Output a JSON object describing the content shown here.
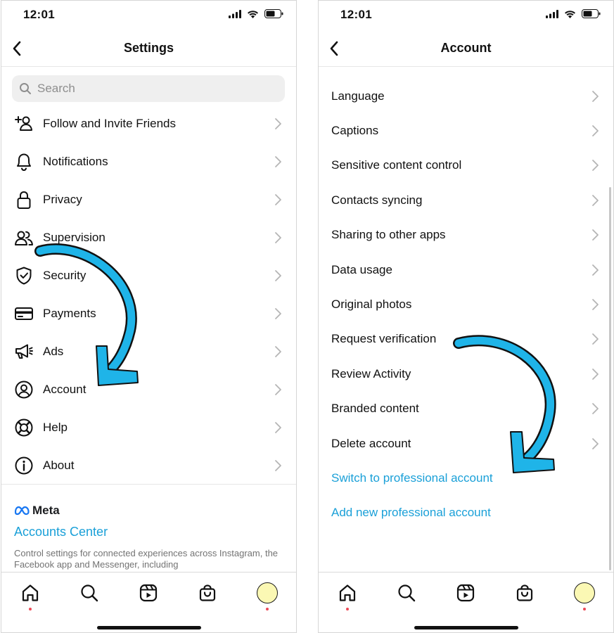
{
  "status": {
    "time": "12:01"
  },
  "left": {
    "title": "Settings",
    "search": {
      "placeholder": "Search",
      "value": ""
    },
    "items": [
      {
        "label": "Follow and Invite Friends",
        "icon": "add-person-icon"
      },
      {
        "label": "Notifications",
        "icon": "bell-icon"
      },
      {
        "label": "Privacy",
        "icon": "lock-icon"
      },
      {
        "label": "Supervision",
        "icon": "people-icon"
      },
      {
        "label": "Security",
        "icon": "shield-check-icon"
      },
      {
        "label": "Payments",
        "icon": "card-icon"
      },
      {
        "label": "Ads",
        "icon": "megaphone-icon"
      },
      {
        "label": "Account",
        "icon": "user-circle-icon"
      },
      {
        "label": "Help",
        "icon": "lifebuoy-icon"
      },
      {
        "label": "About",
        "icon": "info-icon"
      }
    ],
    "meta": {
      "logo": "Meta",
      "accounts_center": "Accounts Center",
      "description": "Control settings for connected experiences across Instagram, the Facebook app and Messenger, including"
    }
  },
  "right": {
    "title": "Account",
    "items": [
      {
        "label": "Language"
      },
      {
        "label": "Captions"
      },
      {
        "label": "Sensitive content control"
      },
      {
        "label": "Contacts syncing"
      },
      {
        "label": "Sharing to other apps"
      },
      {
        "label": "Data usage"
      },
      {
        "label": "Original photos"
      },
      {
        "label": "Request verification"
      },
      {
        "label": "Review Activity"
      },
      {
        "label": "Branded content"
      },
      {
        "label": "Delete account"
      }
    ],
    "links": [
      {
        "label": "Switch to professional account"
      },
      {
        "label": "Add new professional account"
      }
    ]
  },
  "colors": {
    "link": "#1aa0d8",
    "arrow": "#1fb4e8",
    "avatar": "#fbf8b4",
    "notification_dot": "#ed4956"
  },
  "tabs": [
    "home-icon",
    "search-icon",
    "reels-icon",
    "shop-icon",
    "profile-avatar"
  ]
}
